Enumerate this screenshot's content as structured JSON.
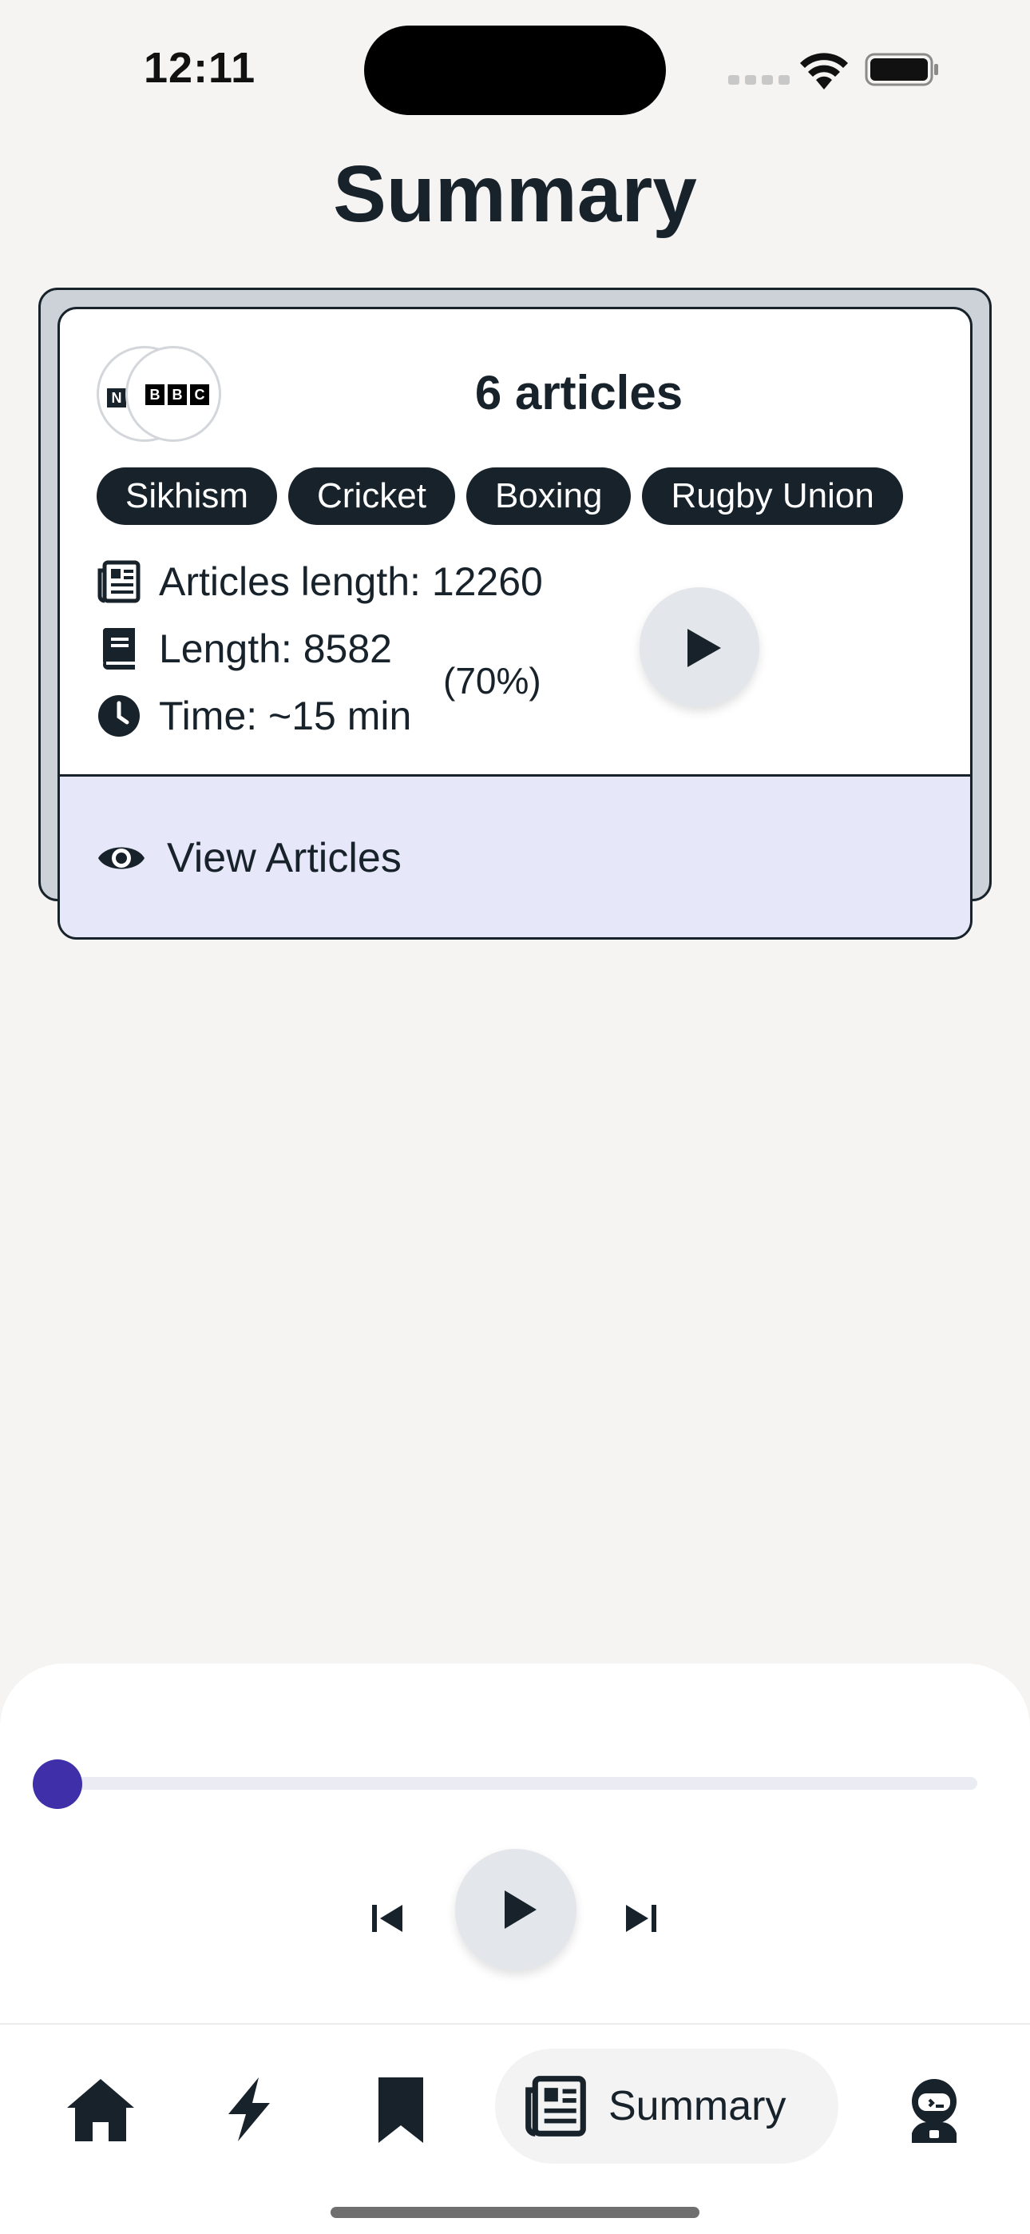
{
  "status_bar": {
    "time": "12:11"
  },
  "page_title": "Summary",
  "card": {
    "source_logo": {
      "n_letter": "N",
      "bbc_letters": [
        "B",
        "B",
        "C"
      ]
    },
    "title": "6 articles",
    "tags": [
      "Sikhism",
      "Cricket",
      "Boxing",
      "Rugby Union"
    ],
    "articles_length": "Articles length: 12260",
    "length": "Length: 8582",
    "time": "Time: ~15 min",
    "percent": "(70%)",
    "view_articles": "View Articles",
    "icons": {
      "articles": "newspaper-icon",
      "length": "book-icon",
      "time": "clock-icon",
      "view": "eye-icon",
      "play": "play-icon"
    }
  },
  "player": {
    "progress": 0,
    "accent_color": "#3f2fa8",
    "controls": [
      "skip-previous-icon",
      "play-icon",
      "skip-next-icon"
    ]
  },
  "nav": {
    "items": [
      "home-icon",
      "bolt-icon",
      "bookmark-icon",
      "newspaper-icon",
      "robot-icon"
    ],
    "active_label": "Summary"
  }
}
